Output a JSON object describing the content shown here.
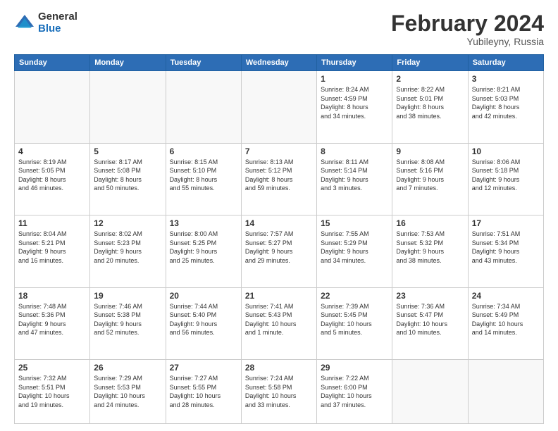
{
  "logo": {
    "general": "General",
    "blue": "Blue"
  },
  "header": {
    "month": "February 2024",
    "location": "Yubileyny, Russia"
  },
  "weekdays": [
    "Sunday",
    "Monday",
    "Tuesday",
    "Wednesday",
    "Thursday",
    "Friday",
    "Saturday"
  ],
  "weeks": [
    [
      {
        "day": "",
        "info": ""
      },
      {
        "day": "",
        "info": ""
      },
      {
        "day": "",
        "info": ""
      },
      {
        "day": "",
        "info": ""
      },
      {
        "day": "1",
        "info": "Sunrise: 8:24 AM\nSunset: 4:59 PM\nDaylight: 8 hours\nand 34 minutes."
      },
      {
        "day": "2",
        "info": "Sunrise: 8:22 AM\nSunset: 5:01 PM\nDaylight: 8 hours\nand 38 minutes."
      },
      {
        "day": "3",
        "info": "Sunrise: 8:21 AM\nSunset: 5:03 PM\nDaylight: 8 hours\nand 42 minutes."
      }
    ],
    [
      {
        "day": "4",
        "info": "Sunrise: 8:19 AM\nSunset: 5:05 PM\nDaylight: 8 hours\nand 46 minutes."
      },
      {
        "day": "5",
        "info": "Sunrise: 8:17 AM\nSunset: 5:08 PM\nDaylight: 8 hours\nand 50 minutes."
      },
      {
        "day": "6",
        "info": "Sunrise: 8:15 AM\nSunset: 5:10 PM\nDaylight: 8 hours\nand 55 minutes."
      },
      {
        "day": "7",
        "info": "Sunrise: 8:13 AM\nSunset: 5:12 PM\nDaylight: 8 hours\nand 59 minutes."
      },
      {
        "day": "8",
        "info": "Sunrise: 8:11 AM\nSunset: 5:14 PM\nDaylight: 9 hours\nand 3 minutes."
      },
      {
        "day": "9",
        "info": "Sunrise: 8:08 AM\nSunset: 5:16 PM\nDaylight: 9 hours\nand 7 minutes."
      },
      {
        "day": "10",
        "info": "Sunrise: 8:06 AM\nSunset: 5:18 PM\nDaylight: 9 hours\nand 12 minutes."
      }
    ],
    [
      {
        "day": "11",
        "info": "Sunrise: 8:04 AM\nSunset: 5:21 PM\nDaylight: 9 hours\nand 16 minutes."
      },
      {
        "day": "12",
        "info": "Sunrise: 8:02 AM\nSunset: 5:23 PM\nDaylight: 9 hours\nand 20 minutes."
      },
      {
        "day": "13",
        "info": "Sunrise: 8:00 AM\nSunset: 5:25 PM\nDaylight: 9 hours\nand 25 minutes."
      },
      {
        "day": "14",
        "info": "Sunrise: 7:57 AM\nSunset: 5:27 PM\nDaylight: 9 hours\nand 29 minutes."
      },
      {
        "day": "15",
        "info": "Sunrise: 7:55 AM\nSunset: 5:29 PM\nDaylight: 9 hours\nand 34 minutes."
      },
      {
        "day": "16",
        "info": "Sunrise: 7:53 AM\nSunset: 5:32 PM\nDaylight: 9 hours\nand 38 minutes."
      },
      {
        "day": "17",
        "info": "Sunrise: 7:51 AM\nSunset: 5:34 PM\nDaylight: 9 hours\nand 43 minutes."
      }
    ],
    [
      {
        "day": "18",
        "info": "Sunrise: 7:48 AM\nSunset: 5:36 PM\nDaylight: 9 hours\nand 47 minutes."
      },
      {
        "day": "19",
        "info": "Sunrise: 7:46 AM\nSunset: 5:38 PM\nDaylight: 9 hours\nand 52 minutes."
      },
      {
        "day": "20",
        "info": "Sunrise: 7:44 AM\nSunset: 5:40 PM\nDaylight: 9 hours\nand 56 minutes."
      },
      {
        "day": "21",
        "info": "Sunrise: 7:41 AM\nSunset: 5:43 PM\nDaylight: 10 hours\nand 1 minute."
      },
      {
        "day": "22",
        "info": "Sunrise: 7:39 AM\nSunset: 5:45 PM\nDaylight: 10 hours\nand 5 minutes."
      },
      {
        "day": "23",
        "info": "Sunrise: 7:36 AM\nSunset: 5:47 PM\nDaylight: 10 hours\nand 10 minutes."
      },
      {
        "day": "24",
        "info": "Sunrise: 7:34 AM\nSunset: 5:49 PM\nDaylight: 10 hours\nand 14 minutes."
      }
    ],
    [
      {
        "day": "25",
        "info": "Sunrise: 7:32 AM\nSunset: 5:51 PM\nDaylight: 10 hours\nand 19 minutes."
      },
      {
        "day": "26",
        "info": "Sunrise: 7:29 AM\nSunset: 5:53 PM\nDaylight: 10 hours\nand 24 minutes."
      },
      {
        "day": "27",
        "info": "Sunrise: 7:27 AM\nSunset: 5:55 PM\nDaylight: 10 hours\nand 28 minutes."
      },
      {
        "day": "28",
        "info": "Sunrise: 7:24 AM\nSunset: 5:58 PM\nDaylight: 10 hours\nand 33 minutes."
      },
      {
        "day": "29",
        "info": "Sunrise: 7:22 AM\nSunset: 6:00 PM\nDaylight: 10 hours\nand 37 minutes."
      },
      {
        "day": "",
        "info": ""
      },
      {
        "day": "",
        "info": ""
      }
    ]
  ]
}
